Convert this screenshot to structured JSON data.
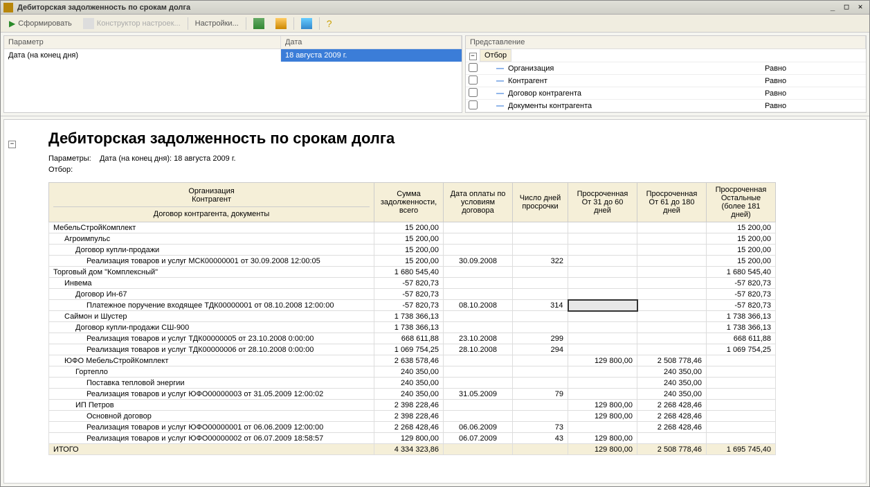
{
  "window": {
    "title": "Дебиторская задолженность по срокам долга"
  },
  "toolbar": {
    "generate": "Сформировать",
    "constructor": "Конструктор настроек...",
    "settings": "Настройки..."
  },
  "params_panel": {
    "header_param": "Параметр",
    "header_date": "Дата",
    "row_label": "Дата (на конец дня)",
    "row_value": "18 августа 2009 г."
  },
  "filter_panel": {
    "header": "Представление",
    "root": "Отбор",
    "rows": [
      {
        "name": "Организация",
        "rel": "Равно"
      },
      {
        "name": "Контрагент",
        "rel": "Равно"
      },
      {
        "name": "Договор контрагента",
        "rel": "Равно"
      },
      {
        "name": "Документы контрагента",
        "rel": "Равно"
      }
    ]
  },
  "report": {
    "title": "Дебиторская задолженность по срокам долга",
    "params_label": "Параметры:",
    "params_value": "Дата (на конец дня): 18 августа 2009 г.",
    "filter_label": "Отбор:",
    "headers": {
      "org_line1": "Организация",
      "org_line2": "Контрагент",
      "org_line3": "Договор контрагента, документы",
      "sum": "Сумма задолженности, всего",
      "pay_date": "Дата оплаты по условиям договора",
      "days": "Число дней просрочки",
      "over_31_60": "Просроченная От 31 до 60 дней",
      "over_61_180": "Просроченная От 61 до 180 дней",
      "over_other": "Просроченная Остальные (более 181 дней)"
    },
    "rows": [
      {
        "lvl": 0,
        "name": "МебельСтройКомплект",
        "sum": "15 200,00",
        "other": "15 200,00"
      },
      {
        "lvl": 1,
        "name": "Агроимпульс",
        "sum": "15 200,00",
        "other": "15 200,00"
      },
      {
        "lvl": 2,
        "name": "Договор купли-продажи",
        "sum": "15 200,00",
        "other": "15 200,00"
      },
      {
        "lvl": 3,
        "name": "Реализация товаров и услуг МСК00000001 от 30.09.2008 12:00:05",
        "sum": "15 200,00",
        "date": "30.09.2008",
        "days": "322",
        "other": "15 200,00"
      },
      {
        "lvl": 0,
        "name": "Торговый дом \"Комплексный\"",
        "sum": "1 680 545,40",
        "other": "1 680 545,40"
      },
      {
        "lvl": 1,
        "name": "Инвема",
        "sum": "-57 820,73",
        "other": "-57 820,73"
      },
      {
        "lvl": 2,
        "name": "Договор Ин-67",
        "sum": "-57 820,73",
        "other": "-57 820,73"
      },
      {
        "lvl": 3,
        "name": "Платежное поручение входящее ТДК00000001 от 08.10.2008 12:00:00",
        "sum": "-57 820,73",
        "date": "08.10.2008",
        "days": "314",
        "other": "-57 820,73",
        "selected": true
      },
      {
        "lvl": 1,
        "name": "Саймон и Шустер",
        "sum": "1 738 366,13",
        "other": "1 738 366,13"
      },
      {
        "lvl": 2,
        "name": "Договор купли-продажи СШ-900",
        "sum": "1 738 366,13",
        "other": "1 738 366,13"
      },
      {
        "lvl": 3,
        "name": "Реализация товаров и услуг ТДК00000005 от 23.10.2008 0:00:00",
        "sum": "668 611,88",
        "date": "23.10.2008",
        "days": "299",
        "other": "668 611,88"
      },
      {
        "lvl": 3,
        "name": "Реализация товаров и услуг ТДК00000006 от 28.10.2008 0:00:00",
        "sum": "1 069 754,25",
        "date": "28.10.2008",
        "days": "294",
        "other": "1 069 754,25"
      },
      {
        "lvl": 1,
        "name": "ЮФО МебельСтройКомплект",
        "sum": "2 638 578,46",
        "o31": "129 800,00",
        "o61": "2 508 778,46"
      },
      {
        "lvl": 2,
        "name": "Гортепло",
        "sum": "240 350,00",
        "o61": "240 350,00"
      },
      {
        "lvl": 3,
        "name": "Поставка тепловой энергии",
        "sum": "240 350,00",
        "o61": "240 350,00"
      },
      {
        "lvl": 3,
        "name": "Реализация товаров и услуг ЮФО00000003 от 31.05.2009 12:00:02",
        "sum": "240 350,00",
        "date": "31.05.2009",
        "days": "79",
        "o61": "240 350,00"
      },
      {
        "lvl": 2,
        "name": "ИП Петров",
        "sum": "2 398 228,46",
        "o31": "129 800,00",
        "o61": "2 268 428,46"
      },
      {
        "lvl": 3,
        "name": "Основной договор",
        "sum": "2 398 228,46",
        "o31": "129 800,00",
        "o61": "2 268 428,46"
      },
      {
        "lvl": 3,
        "name": "Реализация товаров и услуг ЮФО00000001 от 06.06.2009 12:00:00",
        "sum": "2 268 428,46",
        "date": "06.06.2009",
        "days": "73",
        "o61": "2 268 428,46"
      },
      {
        "lvl": 3,
        "name": "Реализация товаров и услуг ЮФО00000002 от 06.07.2009 18:58:57",
        "sum": "129 800,00",
        "date": "06.07.2009",
        "days": "43",
        "o31": "129 800,00"
      }
    ],
    "totals": {
      "name": "ИТОГО",
      "sum": "4 334 323,86",
      "o31": "129 800,00",
      "o61": "2 508 778,46",
      "other": "1 695 745,40"
    }
  }
}
